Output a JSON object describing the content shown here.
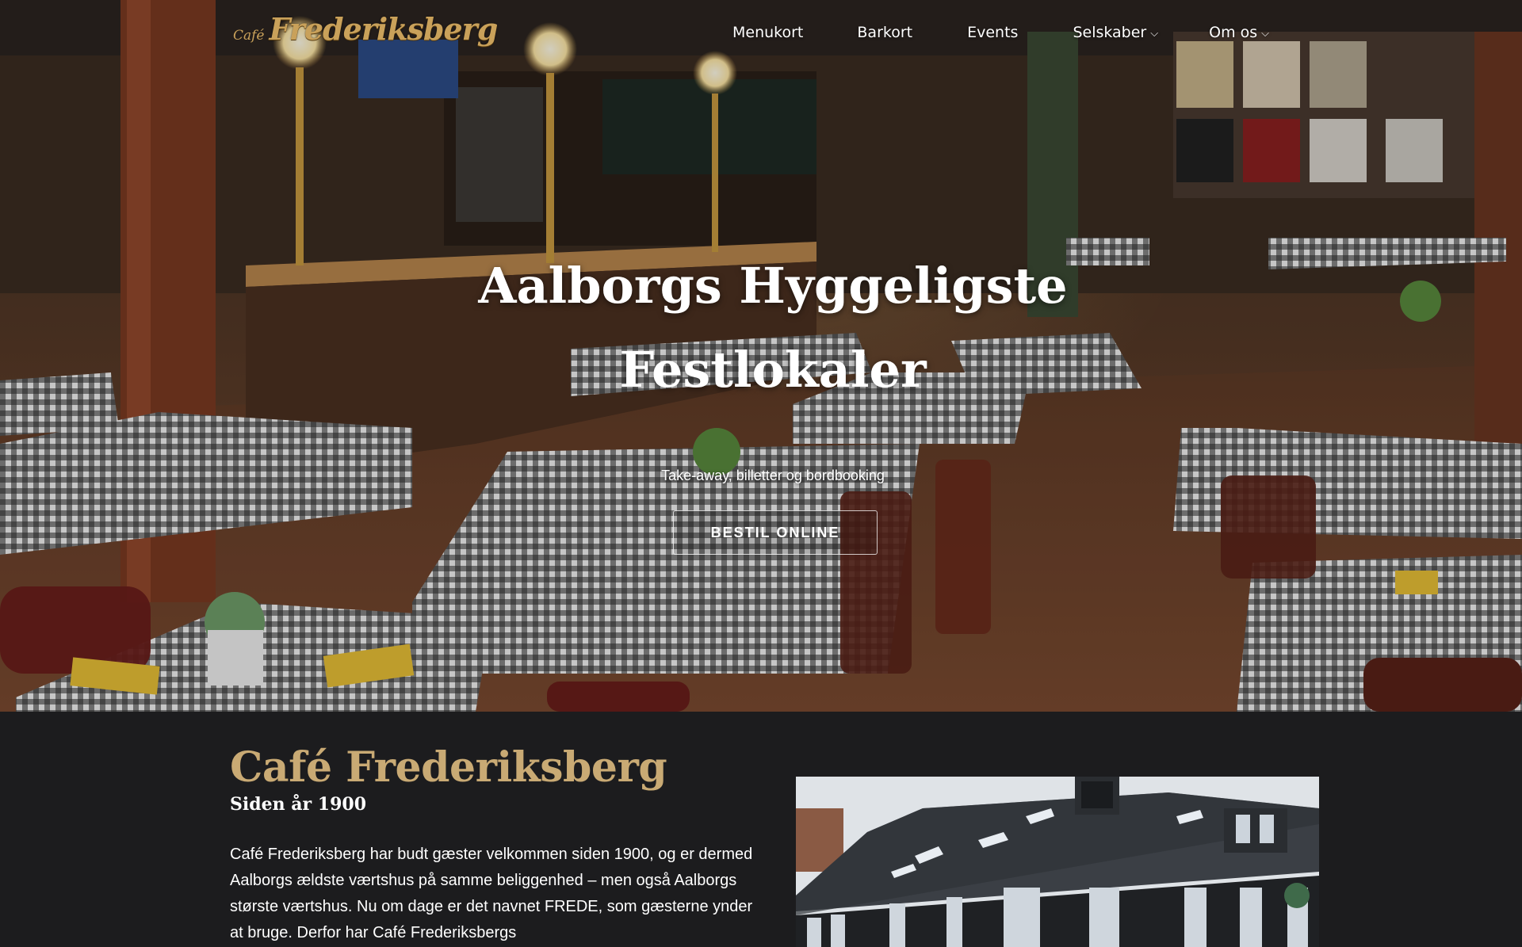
{
  "logo": {
    "small": "Café",
    "big": "Frederiksberg"
  },
  "nav": {
    "items": [
      {
        "label": "Menukort",
        "dropdown": false
      },
      {
        "label": "Barkort",
        "dropdown": false
      },
      {
        "label": "Events",
        "dropdown": false
      },
      {
        "label": "Selskaber",
        "dropdown": true
      },
      {
        "label": "Om os",
        "dropdown": true
      }
    ]
  },
  "hero": {
    "title_line1": "Aalborgs Hyggeligste",
    "title_line2": "Festlokaler",
    "subtitle": "Take-away, billetter og bordbooking",
    "cta": "BESTIL ONLINE"
  },
  "about": {
    "title": "Café Frederiksberg",
    "subtitle": "Siden år 1900",
    "paragraph": "Café Frederiksberg har budt gæster velkommen siden 1900, og er dermed Aalborgs ældste værtshus på samme beliggenhed – men også Aalborgs største værtshus. Nu om dage er det navnet FREDE, som gæsterne ynder at bruge. Derfor har Café Frederiksbergs"
  },
  "colors": {
    "accent_gold": "#c9aa74",
    "page_background": "#1c1c1e",
    "logo_gold": "#c9a15a"
  },
  "icons": {
    "dropdown": "chevron-down-icon"
  }
}
